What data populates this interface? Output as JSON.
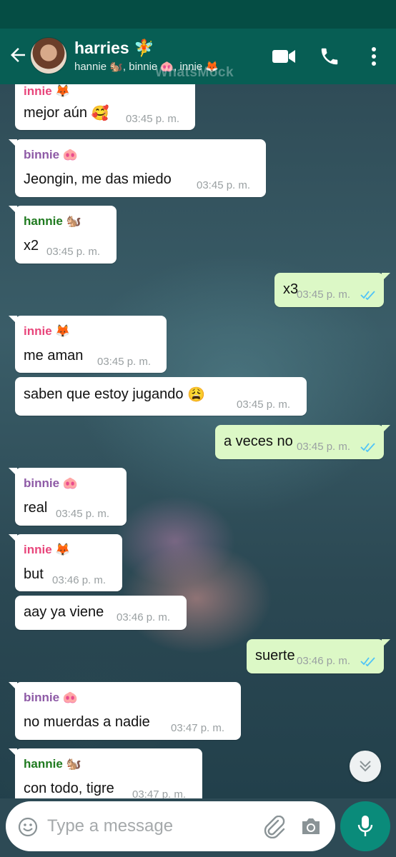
{
  "header": {
    "title": "harries 🧚",
    "participants": "hannie 🐿️, binnie 🐽, innie 🦊",
    "watermark": "WhatsMock"
  },
  "messages": [
    {
      "sender": "innie 🦊",
      "text": "mejor aún",
      "emoji": "🥰",
      "time": "03:45 p. m.",
      "outgoing": false
    },
    {
      "sender": "binnie 🐽",
      "text": "Jeongin, me das miedo",
      "time": "03:45 p. m.",
      "outgoing": false
    },
    {
      "sender": "hannie 🐿️",
      "text": "x2",
      "time": "03:45 p. m.",
      "outgoing": false
    },
    {
      "text": "x3",
      "time": "03:45 p. m.",
      "outgoing": true
    },
    {
      "sender": "innie 🦊",
      "text": "me aman",
      "time": "03:45 p. m.",
      "outgoing": false
    },
    {
      "text": "saben que estoy jugando",
      "emoji": "😩",
      "time": "03:45 p. m.",
      "outgoing": false
    },
    {
      "text": "a veces no",
      "time": "03:45 p. m.",
      "outgoing": true
    },
    {
      "sender": "binnie 🐽",
      "text": "real",
      "time": "03:45 p. m.",
      "outgoing": false
    },
    {
      "sender": "innie 🦊",
      "text": "but",
      "time": "03:46 p. m.",
      "outgoing": false
    },
    {
      "text": "aay ya viene",
      "time": "03:46 p. m.",
      "outgoing": false
    },
    {
      "text": "suerte",
      "time": "03:46 p. m.",
      "outgoing": true
    },
    {
      "sender": "binnie 🐽",
      "text": "no muerdas a nadie",
      "time": "03:47 p. m.",
      "outgoing": false
    },
    {
      "sender": "hannie 🐿️",
      "text": "con todo, tigre",
      "time": "03:47 p. m.",
      "outgoing": false
    }
  ],
  "input": {
    "placeholder": "Type a message"
  },
  "icons": {
    "back": "arrow-left-icon",
    "video": "video-camera-icon",
    "call": "phone-icon",
    "menu": "more-vertical-icon",
    "emoji": "smiley-icon",
    "attach": "paperclip-icon",
    "camera": "camera-icon",
    "mic": "microphone-icon",
    "scroll": "chevron-double-down-icon"
  },
  "colors": {
    "header": "#075e54",
    "statusbar": "#054d44",
    "incoming": "#ffffff",
    "outgoing": "#dcf8c6",
    "read_ticks": "#4fc3f7",
    "mic_button": "#0a8b7a",
    "sender_innie": "#e8467b",
    "sender_binnie": "#8e5aa6",
    "sender_hannie": "#1f7a1f"
  }
}
